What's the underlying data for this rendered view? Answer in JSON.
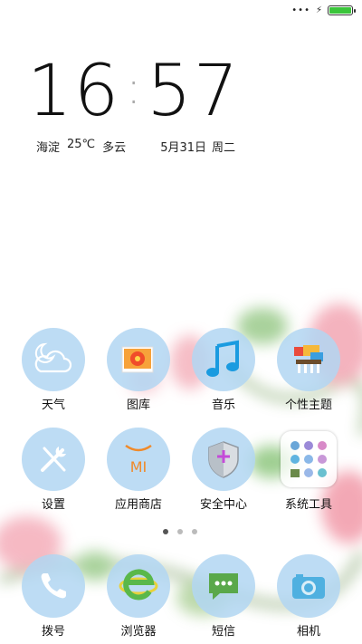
{
  "status_bar": {
    "signal_icon": "more-dots-icon",
    "charging_icon": "bolt-icon",
    "battery_icon": "battery-icon",
    "battery_level": 1.0,
    "battery_color": "#3bc53b"
  },
  "clock": {
    "hours": "16",
    "minutes": "57"
  },
  "weather": {
    "location": "海淀",
    "temperature": "25℃",
    "condition": "多云"
  },
  "date": {
    "day": "5月31日",
    "weekday": "周二"
  },
  "apps": [
    {
      "label": "天气",
      "icon": "weather-icon"
    },
    {
      "label": "图库",
      "icon": "gallery-icon"
    },
    {
      "label": "音乐",
      "icon": "music-icon"
    },
    {
      "label": "个性主题",
      "icon": "themes-icon"
    },
    {
      "label": "设置",
      "icon": "settings-icon"
    },
    {
      "label": "应用商店",
      "icon": "app-store-icon",
      "icon_text": "MI"
    },
    {
      "label": "安全中心",
      "icon": "security-icon"
    },
    {
      "label": "系统工具",
      "icon": "system-tools-folder-icon"
    }
  ],
  "dock": [
    {
      "label": "拨号",
      "icon": "phone-icon"
    },
    {
      "label": "浏览器",
      "icon": "browser-icon"
    },
    {
      "label": "短信",
      "icon": "messages-icon"
    },
    {
      "label": "相机",
      "icon": "camera-icon"
    }
  ],
  "pager": {
    "page_count": 3,
    "current_page": 1
  },
  "colors": {
    "icon_circle": "#b2d6f2",
    "accent_orange": "#f08a2a"
  }
}
